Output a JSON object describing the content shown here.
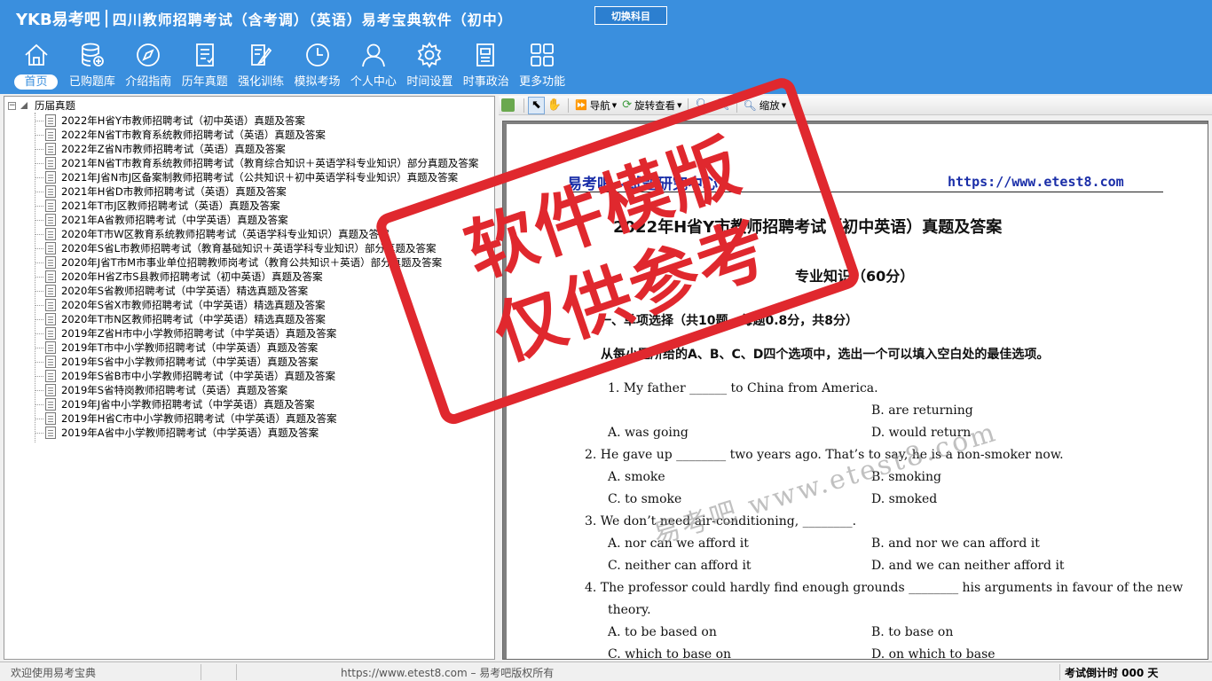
{
  "app": {
    "logo": "YKB易考吧",
    "title": "四川教师招聘考试（含考调）（英语）易考宝典软件（初中）",
    "switch_label": "切换科目"
  },
  "nav": {
    "items": [
      {
        "label": "首页",
        "icon": "home-icon"
      },
      {
        "label": "已购题库",
        "icon": "database-icon"
      },
      {
        "label": "介绍指南",
        "icon": "compass-icon"
      },
      {
        "label": "历年真题",
        "icon": "exam-list-icon"
      },
      {
        "label": "强化训练",
        "icon": "edit-icon"
      },
      {
        "label": "模拟考场",
        "icon": "clock-icon"
      },
      {
        "label": "个人中心",
        "icon": "user-icon"
      },
      {
        "label": "时间设置",
        "icon": "gear-icon"
      },
      {
        "label": "时事政治",
        "icon": "news-icon"
      },
      {
        "label": "更多功能",
        "icon": "grid-icon"
      }
    ]
  },
  "tree": {
    "root": "历届真题",
    "items": [
      "2022年H省Y市教师招聘考试（初中英语）真题及答案",
      "2022年N省T市教育系统教师招聘考试（英语）真题及答案",
      "2022年Z省N市教师招聘考试（英语）真题及答案",
      "2021年N省T市教育系统教师招聘考试（教育综合知识＋英语学科专业知识）部分真题及答案",
      "2021年J省N市J区备案制教师招聘考试（公共知识＋初中英语学科专业知识）真题及答案",
      "2021年H省D市教师招聘考试（英语）真题及答案",
      "2021年T市J区教师招聘考试（英语）真题及答案",
      "2021年A省教师招聘考试（中学英语）真题及答案",
      "2020年T市W区教育系统教师招聘考试（英语学科专业知识）真题及答案",
      "2020年S省L市教师招聘考试（教育基础知识＋英语学科专业知识）部分真题及答案",
      "2020年J省T市M市事业单位招聘教师岗考试（教育公共知识＋英语）部分真题及答案",
      "2020年H省Z市S县教师招聘考试（初中英语）真题及答案",
      "2020年S省教师招聘考试（中学英语）精选真题及答案",
      "2020年S省X市教师招聘考试（中学英语）精选真题及答案",
      "2020年T市N区教师招聘考试（中学英语）精选真题及答案",
      "2019年Z省H市中小学教师招聘考试（中学英语）真题及答案",
      "2019年T市中小学教师招聘考试（中学英语）真题及答案",
      "2019年S省中小学教师招聘考试（中学英语）真题及答案",
      "2019年S省B市中小学教师招聘考试（中学英语）真题及答案",
      "2019年S省特岗教师招聘考试（英语）真题及答案",
      "2019年J省中小学教师招聘考试（中学英语）真题及答案",
      "2019年H省C市中小学教师招聘考试（中学英语）真题及答案",
      "2019年A省中小学教师招聘考试（中学英语）真题及答案"
    ]
  },
  "toolbar": {
    "nav_label": "导航",
    "rotate_label": "旋转查看",
    "zoom_label": "缩放"
  },
  "document": {
    "header_left": "易考吧—试题研究中心",
    "header_right": "https://www.etest8.com",
    "title": "2022年H省Y市教师招聘考试（初中英语）真题及答案",
    "subtitle": "专业知识（60分）",
    "section": "一、单项选择（共10题，每题0.8分，共8分）",
    "instruction": "从每小题所给的A、B、C、D四个选项中，选出一个可以填入空白处的最佳选项。",
    "lines": [
      "1. My father ______ to China from America.",
      "B. are returning",
      "A. was going",
      "D. would return",
      "2. He gave up ________ two years ago. That’s to say, he is a non-smoker now.",
      "A. smoke",
      "B. smoking",
      "C. to smoke",
      "D. smoked",
      "3. We don’t need air-conditioning, ________.",
      "A. nor can we afford it",
      "B. and nor we can afford it",
      "C. neither can afford it",
      "D. and we can neither afford it",
      "4. The professor could hardly find enough grounds ________ his arguments in favour of the new",
      "theory.",
      "A. to be based on",
      "B. to base on",
      "C. which to base on",
      "D. on which to base"
    ],
    "stamp_line1": "软件模版",
    "stamp_line2": "仅供参考",
    "watermark": "易考吧  www.etest8.com"
  },
  "status": {
    "left": "欢迎使用易考宝典",
    "center": "https://www.etest8.com – 易考吧版权所有",
    "right": "考试倒计时 000 天"
  },
  "colors": {
    "header_bg": "#3a8fde",
    "stamp": "#e0282e",
    "doc_header": "#1a2ea8"
  }
}
